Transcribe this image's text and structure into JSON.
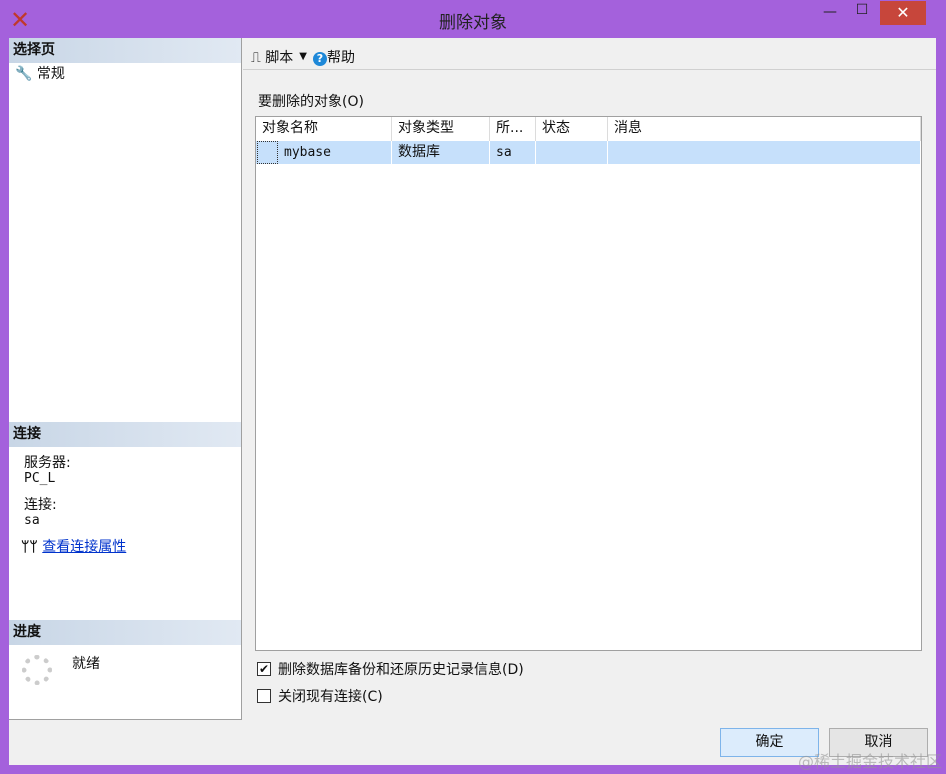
{
  "window": {
    "title": "删除对象",
    "minimize": "—",
    "maximize": "☐",
    "close": "✕"
  },
  "left": {
    "select_page": "选择页",
    "pages": [
      {
        "label": "常规"
      }
    ],
    "connection_header": "连接",
    "server_label": "服务器:",
    "server_value": "PC_L",
    "conn_label": "连接:",
    "conn_value": "sa",
    "view_props": "查看连接属性",
    "progress_header": "进度",
    "progress_status": "就绪"
  },
  "toolbar": {
    "script": "脚本",
    "help": "帮助"
  },
  "main": {
    "objects_label": "要删除的对象(O)",
    "columns": [
      "对象名称",
      "对象类型",
      "所...",
      "状态",
      "消息"
    ],
    "rows": [
      [
        "mybase",
        "数据库",
        "sa",
        "",
        ""
      ]
    ],
    "opt_delete_history": "删除数据库备份和还原历史记录信息(D)",
    "opt_delete_history_checked": true,
    "opt_close_conn": "关闭现有连接(C)",
    "opt_close_conn_checked": false
  },
  "buttons": {
    "ok": "确定",
    "cancel": "取消"
  },
  "watermark": "@稀土掘金技术社区"
}
